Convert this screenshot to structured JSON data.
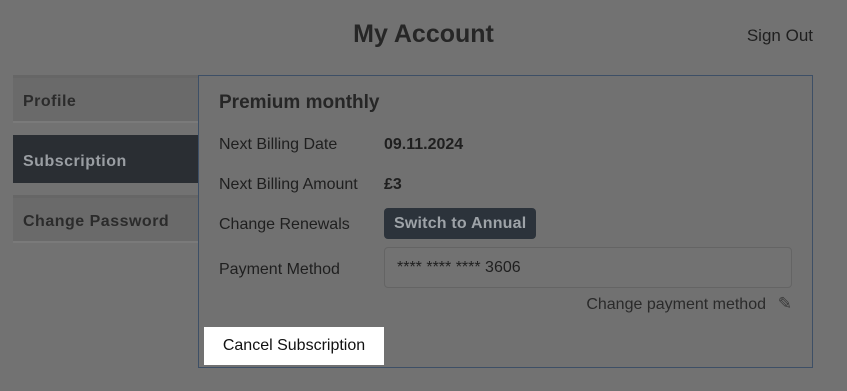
{
  "header": {
    "title": "My Account",
    "sign_out": "Sign Out"
  },
  "tabs": [
    {
      "label": "Profile",
      "active": false
    },
    {
      "label": "Subscription",
      "active": true
    },
    {
      "label": "Change Password",
      "active": false
    }
  ],
  "subscription": {
    "plan": "Premium monthly",
    "next_billing_date_label": "Next Billing Date",
    "next_billing_date": "09.11.2024",
    "next_billing_amount_label": "Next Billing Amount",
    "next_billing_amount": "£3",
    "change_renewals_label": "Change Renewals",
    "switch_button": "Switch to Annual",
    "payment_method_label": "Payment Method",
    "payment_method_value": "**** **** **** 3606",
    "change_payment_link": "Change payment method",
    "pencil_icon": "✎",
    "cancel_button": "Cancel Subscription"
  }
}
